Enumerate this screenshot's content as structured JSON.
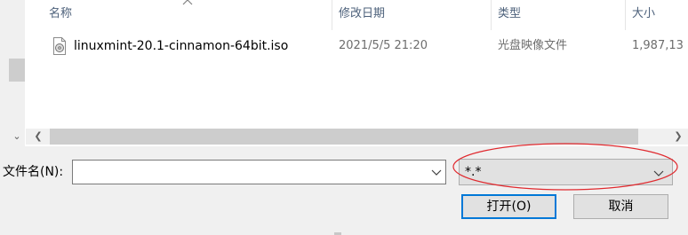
{
  "columns": {
    "name": "名称",
    "modified": "修改日期",
    "type": "类型",
    "size": "大小"
  },
  "files": [
    {
      "name": "linuxmint-20.1-cinnamon-64bit.iso",
      "modified": "2021/5/5 21:20",
      "type": "光盘映像文件",
      "size": "1,987,13",
      "icon": "disc-image-icon"
    }
  ],
  "file_name": {
    "label": "文件名(N):",
    "value": ""
  },
  "filter": {
    "value": "*.*"
  },
  "buttons": {
    "open": "打开(O)",
    "cancel": "取消"
  },
  "colors": {
    "header_text": "#4c607a",
    "highlight_ellipse": "#e0292e",
    "default_button_border": "#0078d7"
  }
}
